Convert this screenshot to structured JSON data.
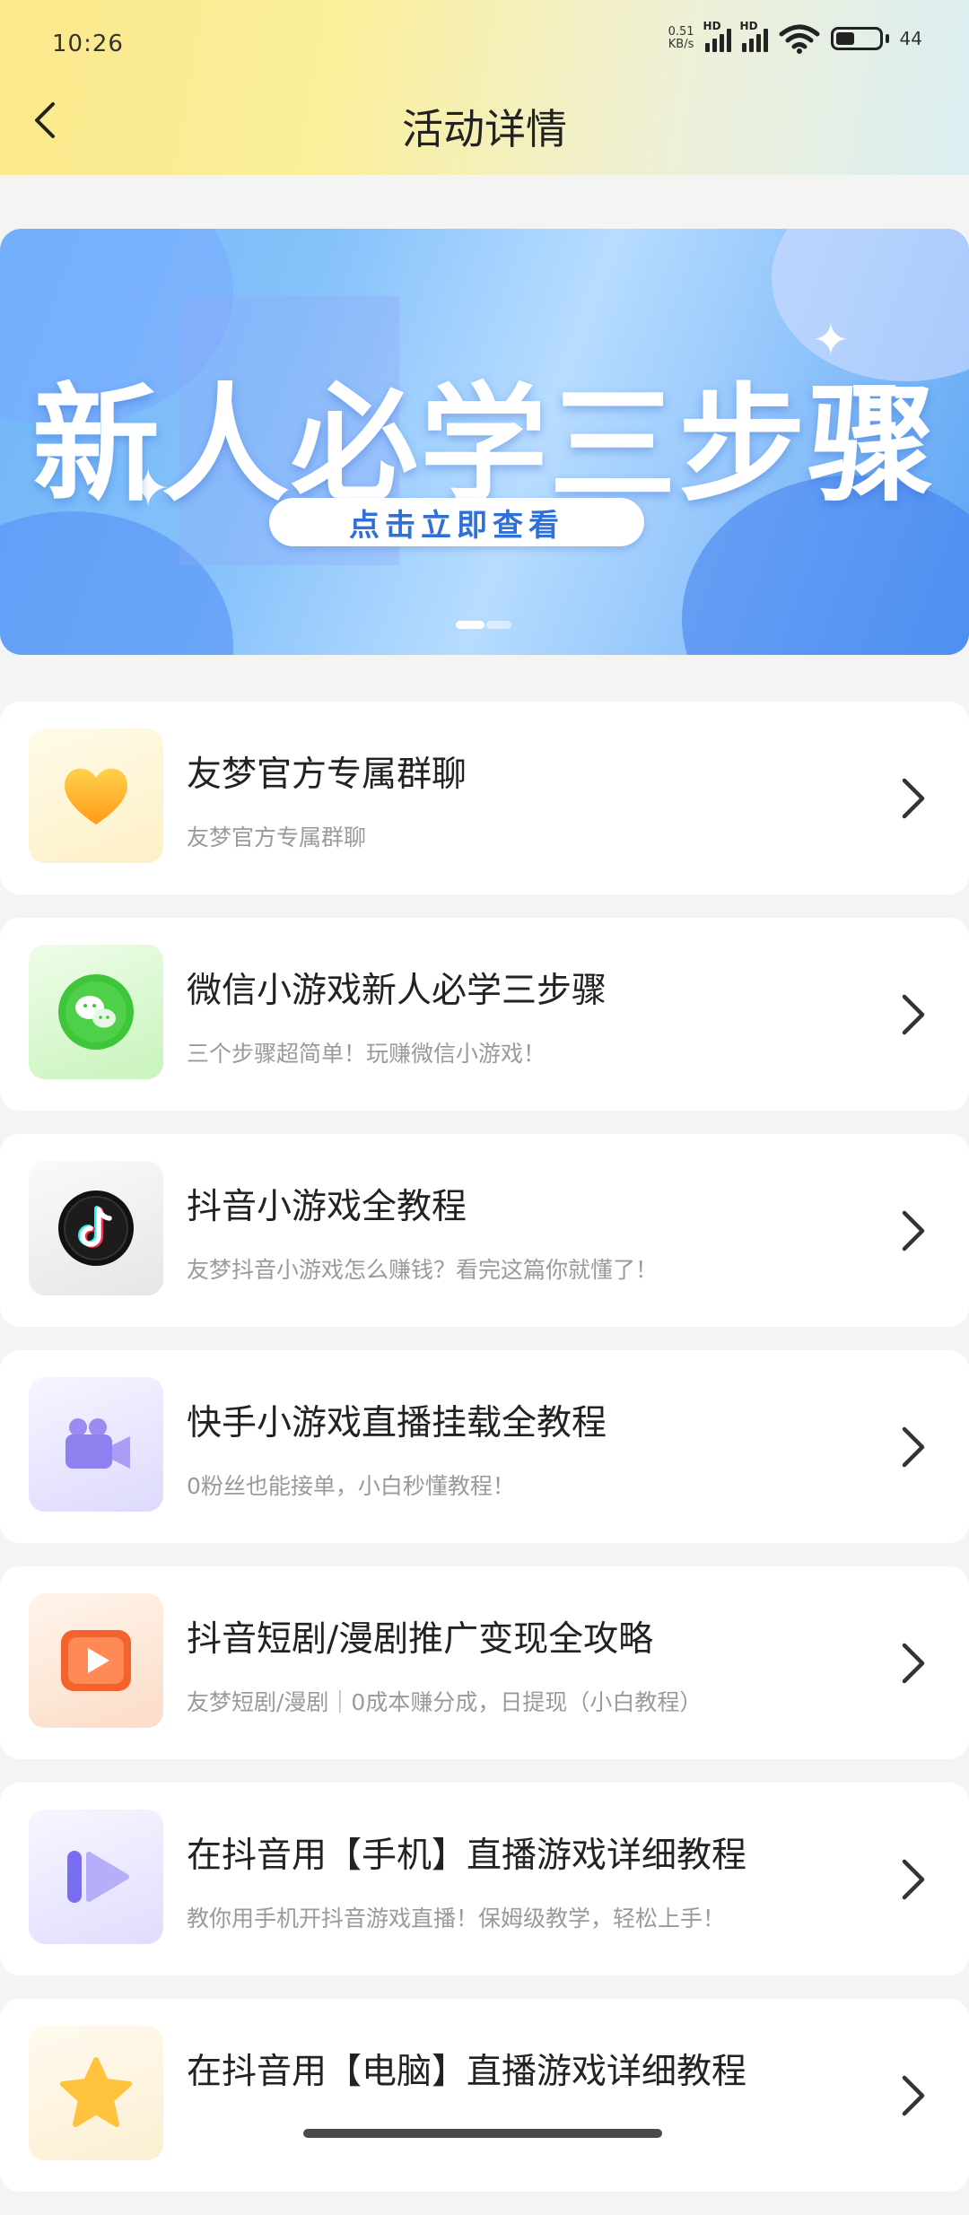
{
  "status": {
    "time": "10:26",
    "speed_value": "0.51",
    "speed_unit": "KB/s",
    "network_1": "HD",
    "network_2": "HD",
    "battery": "44"
  },
  "header": {
    "title": "活动详情"
  },
  "banner": {
    "headline": "新人必学三步骤",
    "cta": "点击立即查看",
    "slides": 2,
    "active_slide": 1
  },
  "items": [
    {
      "title": "友梦官方专属群聊",
      "subtitle": "友梦官方专属群聊",
      "icon": "heart-icon",
      "bg": "#fdf6dc"
    },
    {
      "title": "微信小游戏新人必学三步骤",
      "subtitle": "三个步骤超简单！玩赚微信小游戏！",
      "icon": "wechat-icon",
      "bg": "#e4f9dd"
    },
    {
      "title": "抖音小游戏全教程",
      "subtitle": "友梦抖音小游戏怎么赚钱？看完这篇你就懂了！",
      "icon": "douyin-icon",
      "bg": "#f0f0f0"
    },
    {
      "title": "快手小游戏直播挂载全教程",
      "subtitle": "0粉丝也能接单，小白秒懂教程！",
      "icon": "video-camera-icon",
      "bg": "#ecebfd"
    },
    {
      "title": "抖音短剧/漫剧推广变现全攻略",
      "subtitle": "友梦短剧/漫剧｜0成本赚分成，日提现（小白教程）",
      "icon": "play-icon",
      "bg": "#fdeee2"
    },
    {
      "title": "在抖音用【手机】直播游戏详细教程",
      "subtitle": "教你用手机开抖音游戏直播！保姆级教学，轻松上手！",
      "icon": "live-play-icon",
      "bg": "#ecebfd"
    },
    {
      "title": "在抖音用【电脑】直播游戏详细教程",
      "subtitle": "",
      "icon": "star-icon",
      "bg": "#fdf3de"
    }
  ]
}
